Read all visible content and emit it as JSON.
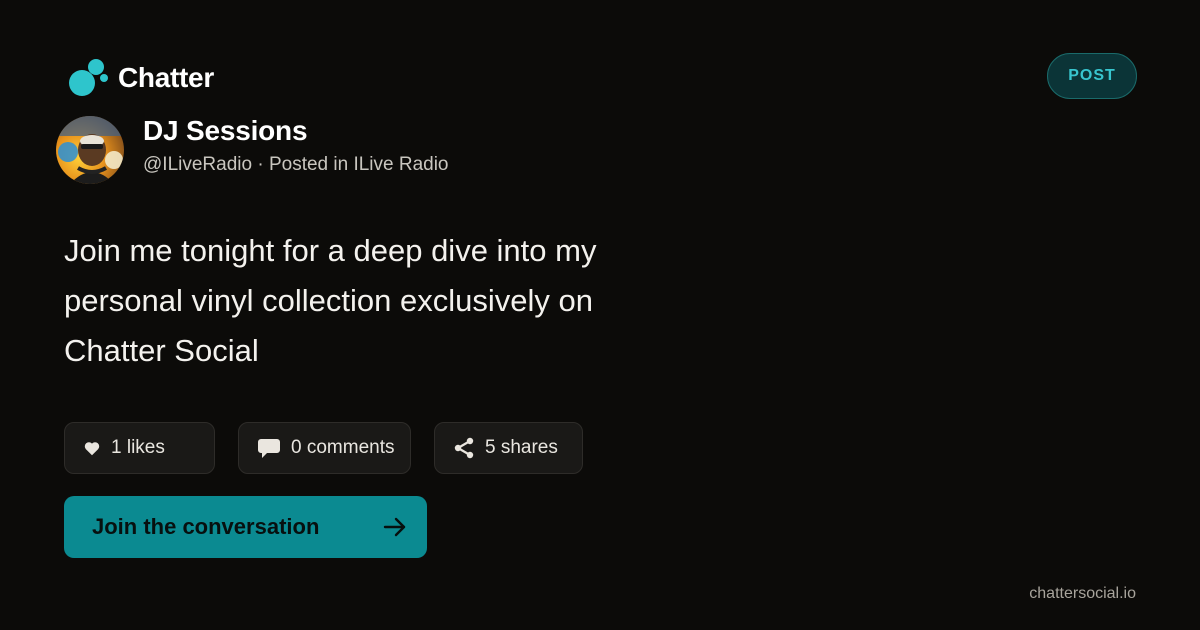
{
  "brand": {
    "name": "Chatter",
    "logo_icon": "chat-bubbles-logo-icon",
    "accent_color": "#2ec5cc"
  },
  "badge": {
    "label": "POST"
  },
  "author": {
    "name": "DJ Sessions",
    "meta": "@ILiveRadio · Posted in ILive Radio",
    "avatar_icon": "avatar"
  },
  "post": {
    "body": "Join me tonight for a deep dive into my personal vinyl collection exclusively on Chatter Social"
  },
  "stats": [
    {
      "icon": "heart-icon",
      "label": "1 likes"
    },
    {
      "icon": "comment-icon",
      "label": "0 comments"
    },
    {
      "icon": "share-icon",
      "label": "5 shares"
    }
  ],
  "cta": {
    "label": "Join the conversation",
    "icon": "arrow-right-icon",
    "color": "#0b8a91"
  },
  "footer": {
    "domain": "chattersocial.io"
  }
}
